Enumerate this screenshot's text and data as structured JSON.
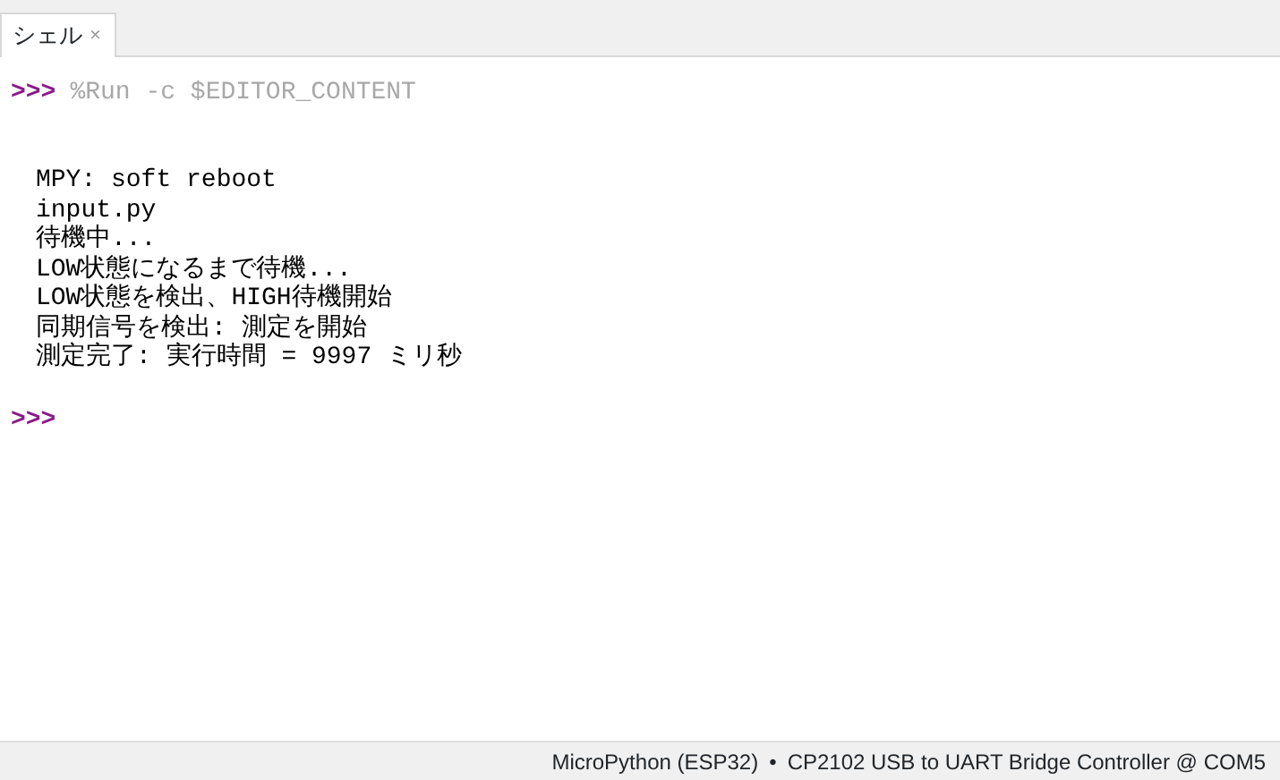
{
  "tabs": [
    {
      "label": "シェル",
      "close": "×",
      "selected": true
    }
  ],
  "shell": {
    "prompt": ">>>",
    "command": "%Run -c $EDITOR_CONTENT",
    "output": [
      "MPY: soft reboot",
      "input.py",
      "待機中...",
      "LOW状態になるまで待機...",
      "LOW状態を検出、HIGH待機開始",
      "同期信号を検出: 測定を開始",
      "測定完了: 実行時間 = 9997 ミリ秒"
    ],
    "final_prompt": ">>>"
  },
  "status_bar": {
    "interpreter": "MicroPython (ESP32)",
    "separator": "•",
    "port": "CP2102 USB to UART Bridge Controller @ COM5"
  }
}
